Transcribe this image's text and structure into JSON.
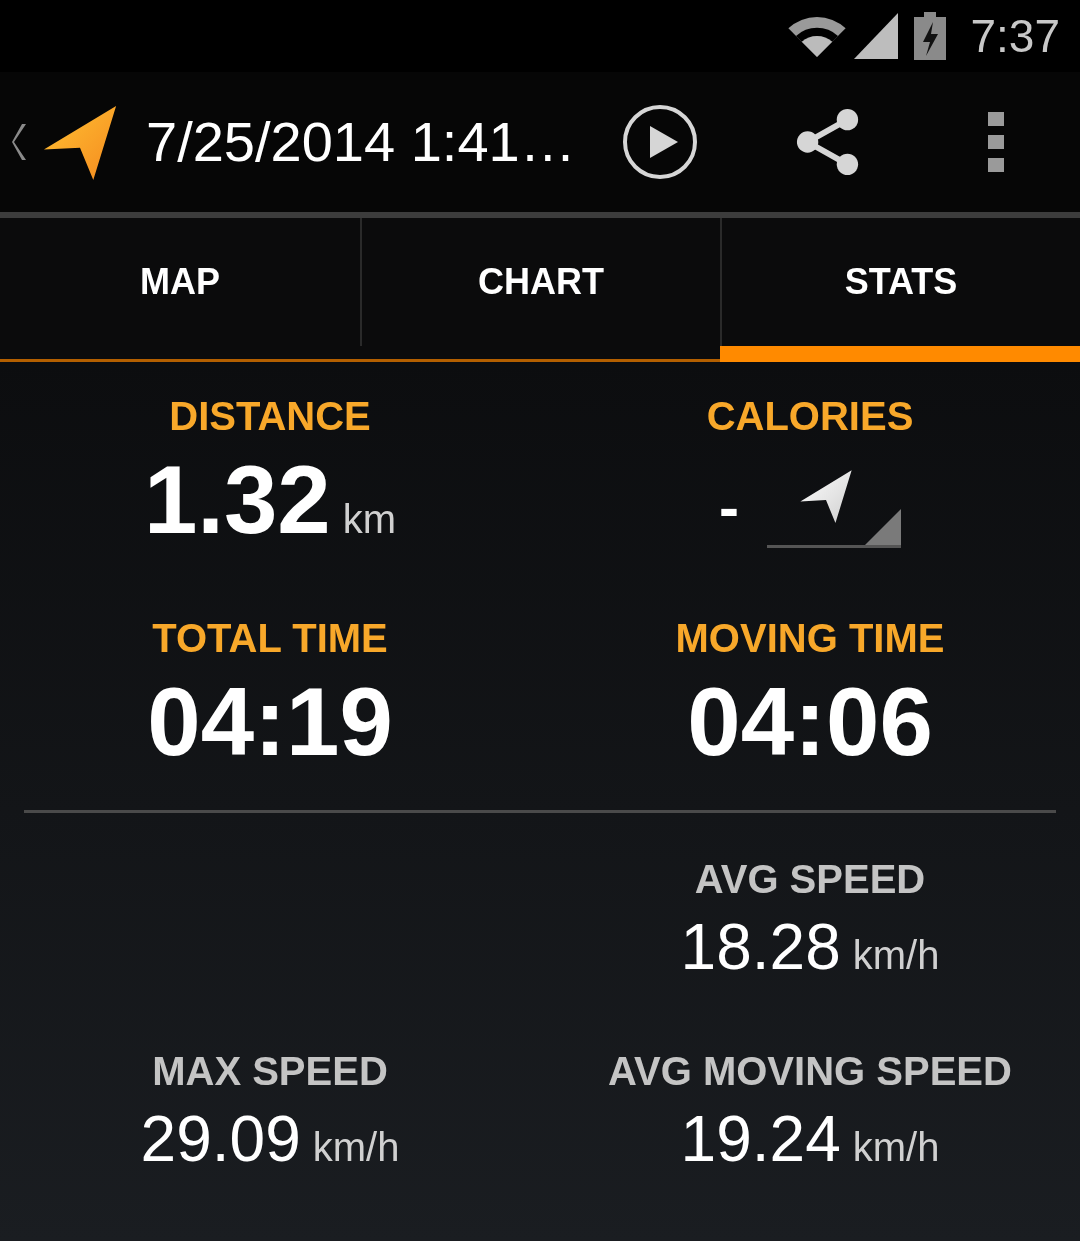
{
  "status_bar": {
    "time": "7:37"
  },
  "action_bar": {
    "title": "7/25/2014 1:41…"
  },
  "tabs": [
    {
      "label": "MAP",
      "selected": false
    },
    {
      "label": "CHART",
      "selected": false
    },
    {
      "label": "STATS",
      "selected": true
    }
  ],
  "summary": [
    {
      "kind": "value",
      "label": "DISTANCE",
      "value": "1.32",
      "unit": "km"
    },
    {
      "kind": "activity",
      "label": "CALORIES",
      "value": "-"
    },
    {
      "kind": "time",
      "label": "TOTAL TIME",
      "value": "04:19"
    },
    {
      "kind": "time",
      "label": "MOVING TIME",
      "value": "04:06"
    }
  ],
  "speeds": [
    {
      "kind": "empty"
    },
    {
      "kind": "speed",
      "label": "AVG SPEED",
      "value": "18.28",
      "unit": "km/h"
    },
    {
      "kind": "speed",
      "label": "MAX SPEED",
      "value": "29.09",
      "unit": "km/h"
    },
    {
      "kind": "speed",
      "label": "AVG MOVING SPEED",
      "value": "19.24",
      "unit": "km/h"
    }
  ]
}
